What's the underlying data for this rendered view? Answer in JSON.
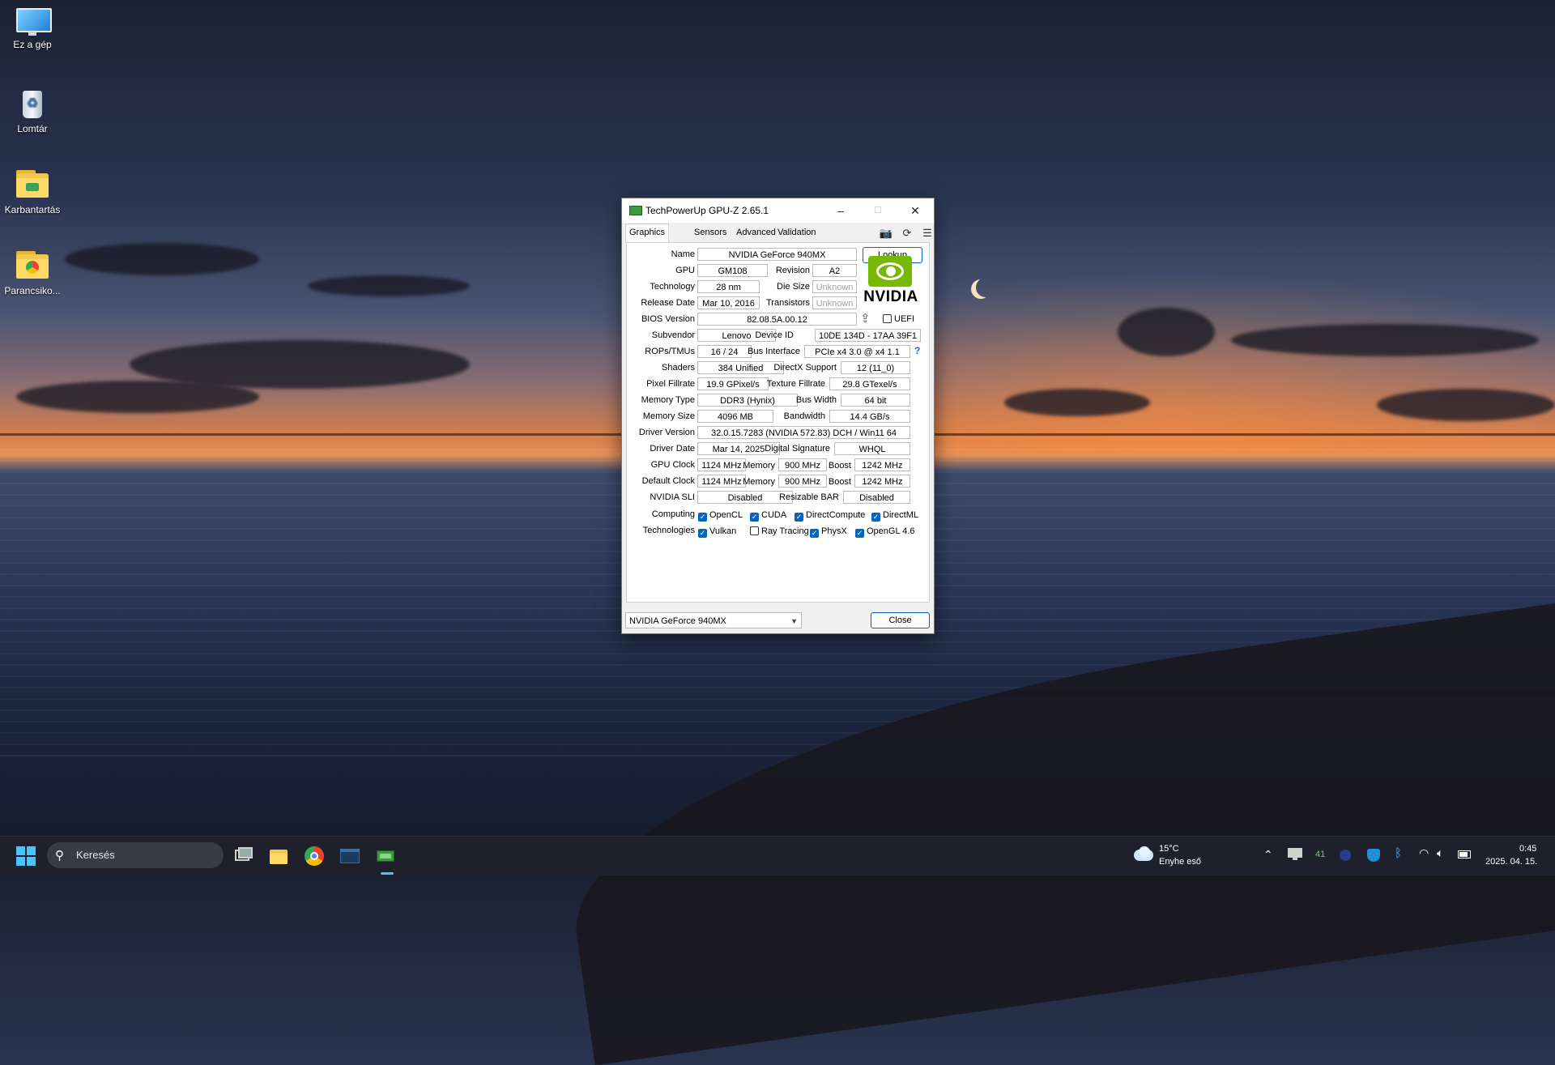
{
  "desktop": {
    "icons": [
      {
        "label": "Ez a gép",
        "icon": "computer-icon"
      },
      {
        "label": "Lomtár",
        "icon": "recycle-bin-icon"
      },
      {
        "label": "Karbantartás",
        "icon": "folder-icon"
      },
      {
        "label": "Parancsiko...",
        "icon": "folder-shortcut-icon"
      }
    ]
  },
  "window": {
    "title": "TechPowerUp GPU-Z 2.65.1",
    "controls": {
      "minimize": "–",
      "maximize": "☐",
      "close": "✕"
    },
    "tabs": [
      "Graphics Card",
      "Sensors",
      "Advanced",
      "Validation"
    ],
    "toolbar": {
      "camera": "camera-icon",
      "refresh": "refresh-icon",
      "menu": "menu-icon"
    },
    "fields": {
      "name_label": "Name",
      "name": "NVIDIA GeForce 940MX",
      "lookup": "Lookup",
      "gpu_label": "GPU",
      "gpu": "GM108",
      "revision_label": "Revision",
      "revision": "A2",
      "technology_label": "Technology",
      "technology": "28 nm",
      "die_size_label": "Die Size",
      "die_size": "Unknown",
      "release_date_label": "Release Date",
      "release_date": "Mar 10, 2016",
      "transistors_label": "Transistors",
      "transistors": "Unknown",
      "bios_label": "BIOS Version",
      "bios": "82.08.5A.00.12",
      "uefi_label": "UEFI",
      "subvendor_label": "Subvendor",
      "subvendor": "Lenovo",
      "device_id_label": "Device ID",
      "device_id": "10DE 134D - 17AA 39F1",
      "rops_label": "ROPs/TMUs",
      "rops": "16 / 24",
      "bus_label": "Bus Interface",
      "bus": "PCIe x4 3.0 @ x4 1.1",
      "shaders_label": "Shaders",
      "shaders": "384 Unified",
      "directx_label": "DirectX Support",
      "directx": "12 (11_0)",
      "pixel_label": "Pixel Fillrate",
      "pixel": "19.9 GPixel/s",
      "texture_label": "Texture Fillrate",
      "texture": "29.8 GTexel/s",
      "memtype_label": "Memory Type",
      "memtype": "DDR3 (Hynix)",
      "buswidth_label": "Bus Width",
      "buswidth": "64 bit",
      "memsize_label": "Memory Size",
      "memsize": "4096 MB",
      "bandwidth_label": "Bandwidth",
      "bandwidth": "14.4 GB/s",
      "driver_label": "Driver Version",
      "driver": "32.0.15.7283 (NVIDIA 572.83) DCH / Win11 64",
      "driverdate_label": "Driver Date",
      "driverdate": "Mar 14, 2025",
      "signature_label": "Digital Signature",
      "signature": "WHQL",
      "gpuclock_label": "GPU Clock",
      "gpuclock": "1124 MHz",
      "memory_label": "Memory",
      "gpu_mem": "900 MHz",
      "boost_label": "Boost",
      "gpu_boost": "1242 MHz",
      "defclock_label": "Default Clock",
      "defclock": "1124 MHz",
      "def_mem": "900 MHz",
      "def_boost": "1242 MHz",
      "sli_label": "NVIDIA SLI",
      "sli": "Disabled",
      "rebar_label": "Resizable BAR",
      "rebar": "Disabled",
      "computing_label": "Computing",
      "technologies_label": "Technologies"
    },
    "computing": [
      {
        "label": "OpenCL",
        "checked": true
      },
      {
        "label": "CUDA",
        "checked": true
      },
      {
        "label": "DirectCompute",
        "checked": true
      },
      {
        "label": "DirectML",
        "checked": true
      }
    ],
    "technologies": [
      {
        "label": "Vulkan",
        "checked": true
      },
      {
        "label": "Ray Tracing",
        "checked": false
      },
      {
        "label": "PhysX",
        "checked": true
      },
      {
        "label": "OpenGL 4.6",
        "checked": true
      }
    ],
    "logo_text": "NVIDIA",
    "help": "?",
    "share_glyph": "⇪",
    "gpu_select": "NVIDIA GeForce 940MX",
    "close_button": "Close"
  },
  "taskbar": {
    "search_placeholder": "Keresés",
    "weather_temp": "15°C",
    "weather_desc": "Enyhe eső",
    "tray_count": "41",
    "time": "0:45",
    "date": "2025. 04. 15."
  }
}
